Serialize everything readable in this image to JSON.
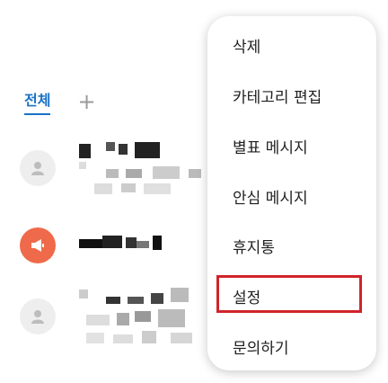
{
  "tabs": {
    "all": "전체",
    "add": "+"
  },
  "menu": {
    "items": [
      {
        "label": "삭제"
      },
      {
        "label": "카테고리 편집"
      },
      {
        "label": "별표 메시지"
      },
      {
        "label": "안심 메시지"
      },
      {
        "label": "휴지통"
      },
      {
        "label": "설정"
      },
      {
        "label": "문의하기"
      }
    ],
    "highlighted": "설정"
  },
  "colors": {
    "accent": "#1a73c7",
    "highlight": "#d1232a",
    "avatar_orange": "#ef6a4a"
  }
}
